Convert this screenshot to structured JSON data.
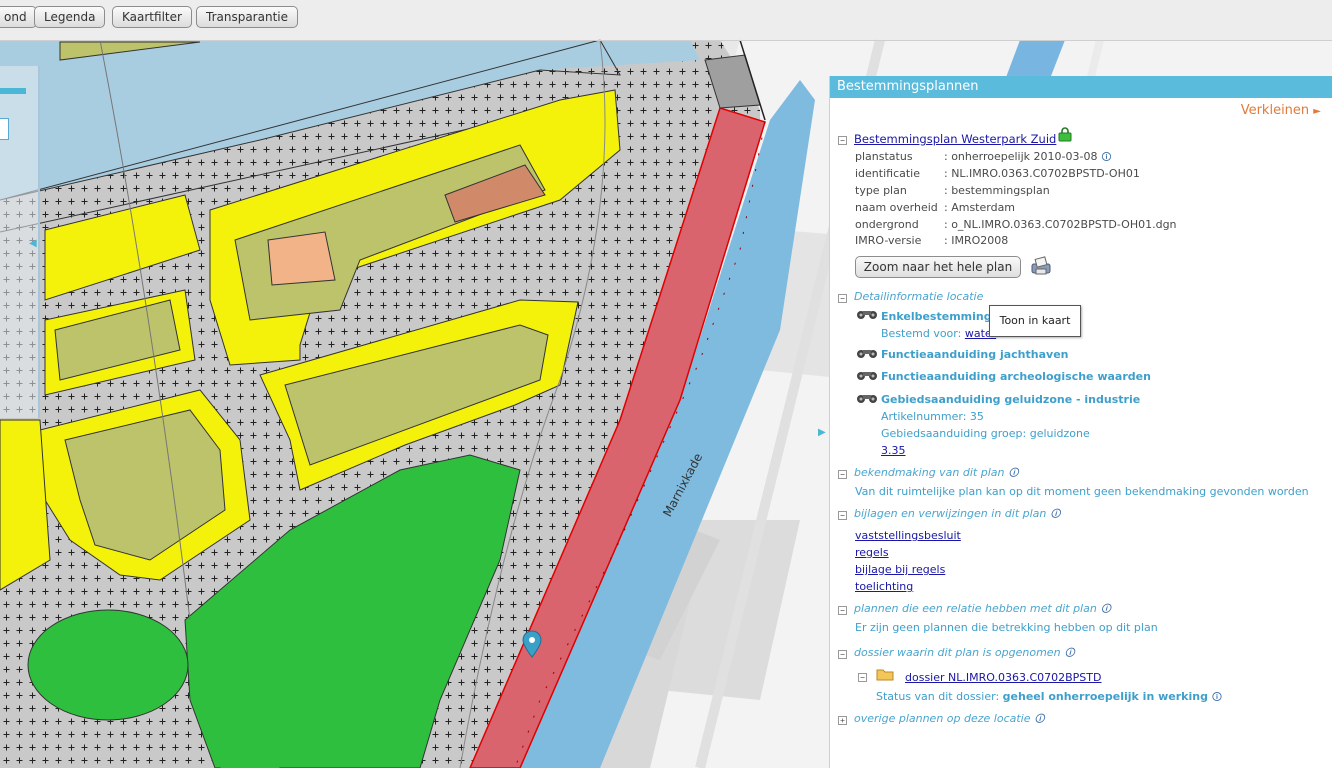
{
  "toolbar": {
    "buttons": [
      "ond",
      "Legenda",
      "Kaartfilter",
      "Transparantie"
    ]
  },
  "map": {
    "street_name": "Marnixkade",
    "selected_color": "#d9646e",
    "water_color": "#a9cde0",
    "green_color": "#2fbf3e",
    "yellow_color": "#f4f20a"
  },
  "panel": {
    "title": "Bestemmingsplannen",
    "shrink_label": "Verkleinen",
    "shrink_icon": "arrow-right-icon",
    "plan": {
      "name": "Bestemmingsplan Westerpark Zuid",
      "lock_icon": "green-lock-icon",
      "fields": [
        {
          "label": "planstatus",
          "value": ": onherroepelijk 2010-03-08"
        },
        {
          "label": "identificatie",
          "value": ": NL.IMRO.0363.C0702BPSTD-OH01"
        },
        {
          "label": "type plan",
          "value": ": bestemmingsplan"
        },
        {
          "label": "naam overheid",
          "value": ": Amsterdam"
        },
        {
          "label": "ondergrond",
          "value": ": o_NL.IMRO.0363.C0702BPSTD-OH01.dgn"
        },
        {
          "label": "IMRO-versie",
          "value": ": IMRO2008"
        }
      ],
      "zoom_button": "Zoom naar het hele plan",
      "print_icon": "printer-icon"
    },
    "detail": {
      "heading": "Detailinformatie locatie",
      "tooltip": "Toon in kaart",
      "items": [
        {
          "title": "Enkelbestemming",
          "sub_label": "Bestemd voor:",
          "sub_link": "water"
        },
        {
          "title": "Functieaanduiding jachthaven"
        },
        {
          "title": "Functieaanduiding archeologische waarden"
        },
        {
          "title": "Gebiedsaanduiding geluidzone - industrie",
          "lines": [
            "Artikelnummer: 35",
            "Gebiedsaanduiding groep: geluidzone"
          ],
          "link": "3.35"
        }
      ]
    },
    "bekendmaking": {
      "heading": "bekendmaking van dit plan",
      "text": "Van dit ruimtelijke plan kan op dit moment geen bekendmaking gevonden worden"
    },
    "bijlagen": {
      "heading": "bijlagen en verwijzingen in dit plan",
      "links": [
        "vaststellingsbesluit",
        "regels",
        "bijlage bij regels",
        "toelichting"
      ]
    },
    "relaties": {
      "heading": "plannen die een relatie hebben met dit plan",
      "text": "Er zijn geen plannen die betrekking hebben op dit plan"
    },
    "dossier": {
      "heading": "dossier waarin dit plan is opgenomen",
      "name": "dossier NL.IMRO.0363.C0702BPSTD",
      "status_label": "Status van dit dossier:",
      "status_value": "geheel onherroepelijk in werking"
    },
    "overige": {
      "heading": "overige plannen op deze locatie"
    }
  }
}
